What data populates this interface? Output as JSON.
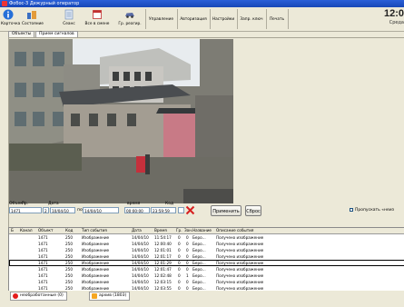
{
  "window": {
    "title": "Фобос-3 Дежурный оператор"
  },
  "toolbar": {
    "buttons": [
      {
        "label": "Карточка",
        "icon": "info-icon"
      },
      {
        "label": "Состояние",
        "icon": "state-icon"
      },
      {
        "label": "Сеанс",
        "icon": "session-icon"
      },
      {
        "label": "Все в смене",
        "icon": "shift-icon"
      },
      {
        "label": "Гр. реагир.",
        "icon": "car-icon"
      },
      {
        "label": "Управление",
        "icon": ""
      },
      {
        "label": "Авторизация",
        "icon": ""
      },
      {
        "label": "Настройки",
        "icon": ""
      },
      {
        "label": "Запр. ключ",
        "icon": ""
      },
      {
        "label": "Печать",
        "icon": ""
      }
    ],
    "clock": "12:0",
    "date": "Среда"
  },
  "tabs": [
    "Объекты",
    "Прием сигналов"
  ],
  "filter": {
    "object_label": "Объект",
    "group_label": "Гр.",
    "date_label": "Дата",
    "time_label": "время",
    "code_label": "Код",
    "object_value": "1471",
    "group_value": "2",
    "date_from": "10/04/10",
    "date_to_label": "по",
    "date_to": "14/04/10",
    "time_from": "00:00:00",
    "time_to": "23:59:59",
    "apply_label": "Применить",
    "reset_label": "Сброс",
    "skip_label": "Пропускать «неиз"
  },
  "table": {
    "columns": [
      "Б",
      "Канал",
      "Объект",
      "Код",
      "Тип события",
      "Дата",
      "Время",
      "Гр.",
      "Зон.",
      "Название",
      "Описание события"
    ],
    "rows": [
      [
        "",
        "",
        "1471",
        "250",
        "Изображение",
        "14/04/10",
        "11:54:17",
        "0",
        "0",
        "Беро...",
        "Получено изображение"
      ],
      [
        "",
        "",
        "1471",
        "250",
        "Изображение",
        "14/04/10",
        "12:00:40",
        "0",
        "0",
        "Беро...",
        "Получено изображение"
      ],
      [
        "",
        "",
        "1471",
        "250",
        "Изображение",
        "14/04/10",
        "12:01:01",
        "0",
        "0",
        "Беро...",
        "Получено изображение"
      ],
      [
        "",
        "",
        "1471",
        "250",
        "Изображение",
        "14/04/10",
        "12:01:17",
        "0",
        "0",
        "Беро...",
        "Получено изображение"
      ],
      [
        "",
        "",
        "1471",
        "250",
        "Изображение",
        "14/04/10",
        "12:01:29",
        "0",
        "0",
        "Беро...",
        "Получено изображение"
      ],
      [
        "",
        "",
        "1471",
        "250",
        "Изображение",
        "14/04/10",
        "12:01:47",
        "0",
        "0",
        "Беро...",
        "Получено изображение"
      ],
      [
        "",
        "",
        "1471",
        "250",
        "Изображение",
        "14/04/10",
        "12:02:48",
        "0",
        "1",
        "Беро...",
        "Получено изображение"
      ],
      [
        "",
        "",
        "1471",
        "250",
        "Изображение",
        "14/04/10",
        "12:03:15",
        "0",
        "0",
        "Беро...",
        "Получено изображение"
      ],
      [
        "",
        "",
        "1471",
        "250",
        "Изображение",
        "14/04/10",
        "12:03:55",
        "0",
        "0",
        "Беро...",
        "Получено изображение"
      ]
    ],
    "selected_row": 4
  },
  "status": {
    "unprocessed": "необработанные (0)",
    "archive": "архив (1803)"
  },
  "colors": {
    "title_blue": "#2a5fd8",
    "status_red": "#e31b1b",
    "archive_orange": "#f5a623",
    "cancel_red": "#d62020"
  }
}
